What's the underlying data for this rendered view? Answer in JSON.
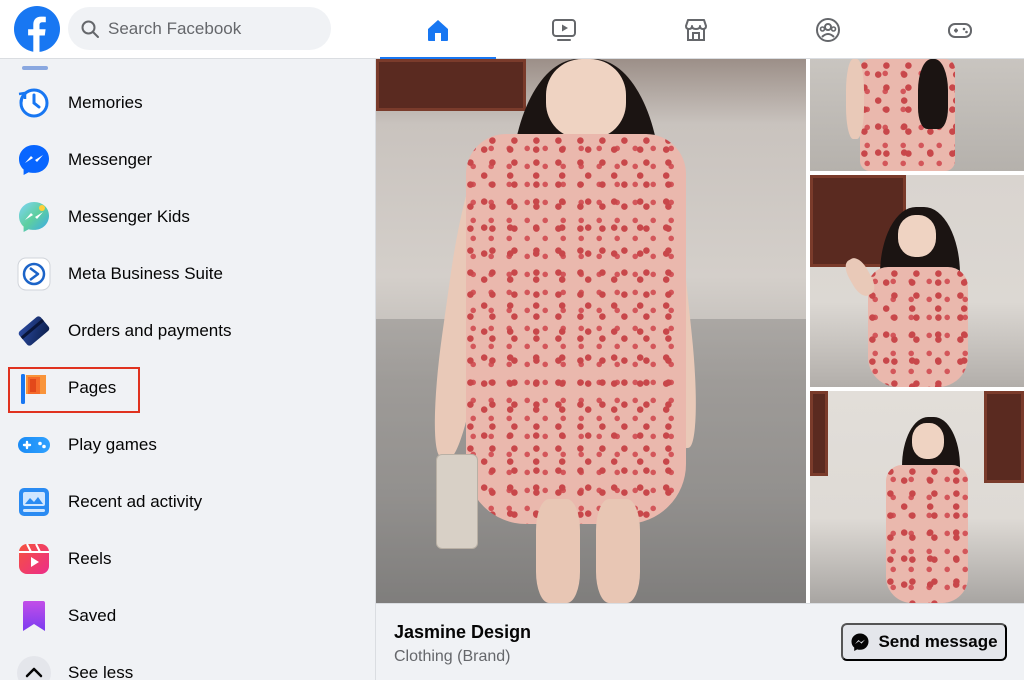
{
  "search": {
    "placeholder": "Search Facebook"
  },
  "nav": {
    "tabs": [
      {
        "id": "home",
        "icon": "home-icon",
        "active": true
      },
      {
        "id": "watch",
        "icon": "video-icon",
        "active": false
      },
      {
        "id": "marketplace",
        "icon": "marketplace-icon",
        "active": false
      },
      {
        "id": "groups",
        "icon": "groups-icon",
        "active": false
      },
      {
        "id": "gaming",
        "icon": "gamepad-icon",
        "active": false
      }
    ]
  },
  "sidebar": {
    "items": [
      {
        "label": "Memories",
        "icon": "memories-icon"
      },
      {
        "label": "Messenger",
        "icon": "messenger-icon"
      },
      {
        "label": "Messenger Kids",
        "icon": "messenger-kids-icon"
      },
      {
        "label": "Meta Business Suite",
        "icon": "business-suite-icon"
      },
      {
        "label": "Orders and payments",
        "icon": "card-icon"
      },
      {
        "label": "Pages",
        "icon": "flag-icon",
        "highlighted": true
      },
      {
        "label": "Play games",
        "icon": "gamepad-icon"
      },
      {
        "label": "Recent ad activity",
        "icon": "ad-activity-icon"
      },
      {
        "label": "Reels",
        "icon": "reels-icon"
      },
      {
        "label": "Saved",
        "icon": "bookmark-icon"
      },
      {
        "label": "See less",
        "icon": "chevron-up-icon"
      }
    ]
  },
  "page_card": {
    "name": "Jasmine Design",
    "category": "Clothing (Brand)",
    "send_label": "Send message"
  },
  "colors": {
    "brand": "#1877f2",
    "highlight": "#e0321f"
  }
}
